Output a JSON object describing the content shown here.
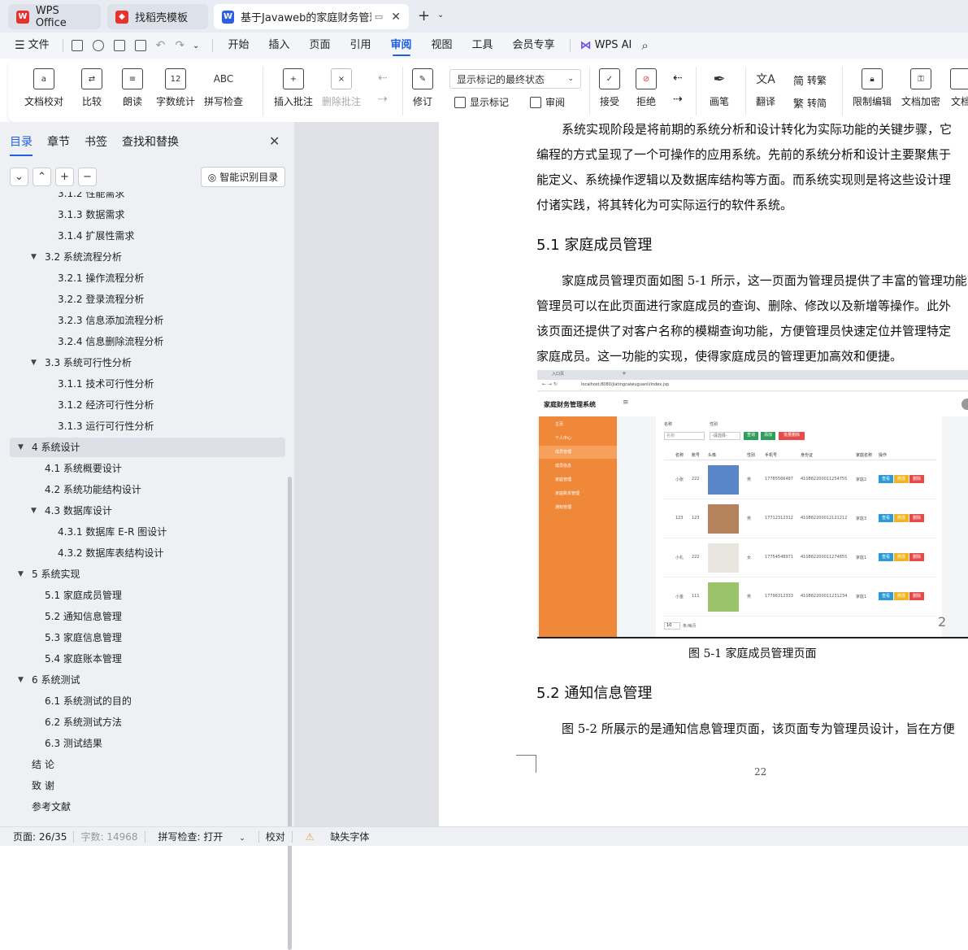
{
  "tabs": [
    {
      "label": "WPS Office"
    },
    {
      "label": "找稻壳模板"
    },
    {
      "label": "基于Javaweb的家庭财务管理"
    }
  ],
  "menu": {
    "file": "文件",
    "items": [
      "开始",
      "插入",
      "页面",
      "引用",
      "审阅",
      "视图",
      "工具",
      "会员专享"
    ],
    "active": "审阅",
    "ai": "WPS AI"
  },
  "ribbon": {
    "proofread": "文档校对",
    "compare": "比较",
    "read_aloud": "朗读",
    "word_count": "字数统计",
    "spell_check": "拼写检查",
    "insert_comment": "插入批注",
    "delete_comment": "删除批注",
    "revise": "修订",
    "display_mode": "显示标记的最终状态",
    "show_markup": "显示标记",
    "review": "审阅",
    "accept": "接受",
    "reject": "拒绝",
    "pen": "画笔",
    "translate": "翻译",
    "to_traditional": "转繁",
    "to_simplified": "转简",
    "restrict_edit": "限制编辑",
    "encrypt": "文档加密",
    "more": "文档"
  },
  "sidebar": {
    "tabs": [
      "目录",
      "章节",
      "书签",
      "查找和替换"
    ],
    "smart_btn": "智能识别目录",
    "toc": [
      {
        "label": "3.1.2 性能需求",
        "level": 3
      },
      {
        "label": "3.1.3 数据需求",
        "level": 3
      },
      {
        "label": "3.1.4 扩展性需求",
        "level": 3
      },
      {
        "label": "3.2 系统流程分析",
        "level": 2,
        "arrow": true
      },
      {
        "label": "3.2.1  操作流程分析",
        "level": 3
      },
      {
        "label": "3.2.2  登录流程分析",
        "level": 3
      },
      {
        "label": "3.2.3  信息添加流程分析",
        "level": 3
      },
      {
        "label": "3.2.4  信息删除流程分析",
        "level": 3
      },
      {
        "label": "3.3  系统可行性分析",
        "level": 2,
        "arrow": true
      },
      {
        "label": "3.1.1  技术可行性分析",
        "level": 3
      },
      {
        "label": "3.1.2  经济可行性分析",
        "level": 3
      },
      {
        "label": "3.1.3  运行可行性分析",
        "level": 3
      },
      {
        "label": "4  系统设计",
        "level": 1,
        "arrow": true,
        "selected": true
      },
      {
        "label": "4.1  系统概要设计",
        "level": 2
      },
      {
        "label": "4.2  系统功能结构设计",
        "level": 2
      },
      {
        "label": "4.3  数据库设计",
        "level": 2,
        "arrow": true
      },
      {
        "label": "4.3.1  数据库 E-R 图设计",
        "level": 3
      },
      {
        "label": "4.3.2  数据库表结构设计",
        "level": 3
      },
      {
        "label": "5  系统实现",
        "level": 1,
        "arrow": true
      },
      {
        "label": "5.1 家庭成员管理",
        "level": 2
      },
      {
        "label": "5.2  通知信息管理",
        "level": 2
      },
      {
        "label": "5.3 家庭信息管理",
        "level": 2
      },
      {
        "label": "5.4 家庭账本管理",
        "level": 2
      },
      {
        "label": "6  系统测试",
        "level": 1,
        "arrow": true
      },
      {
        "label": "6.1 系统测试的目的",
        "level": 2
      },
      {
        "label": "6.2 系统测试方法",
        "level": 2
      },
      {
        "label": "6.3  测试结果",
        "level": 2
      },
      {
        "label": "结   论",
        "level": 1
      },
      {
        "label": "致   谢",
        "level": 1
      },
      {
        "label": "参考文献",
        "level": 1
      }
    ]
  },
  "document": {
    "para1_lines": [
      "系统实现阶段是将前期的系统分析和设计转化为实际功能的关键步骤，它",
      "编程的方式呈现了一个可操作的应用系统。先前的系统分析和设计主要聚焦于",
      "能定义、系统操作逻辑以及数据库结构等方面。而系统实现则是将这些设计理",
      "付诸实践，将其转化为可实际运行的软件系统。"
    ],
    "heading1": "5.1 家庭成员管理",
    "para2_lines": [
      "家庭成员管理页面如图 5-1 所示，这一页面为管理员提供了丰富的管理功能",
      "管理员可以在此页面进行家庭成员的查询、删除、修改以及新增等操作。此外",
      "该页面还提供了对客户名称的模糊查询功能，方便管理员快速定位并管理特定",
      "家庭成员。这一功能的实现，使得家庭成员的管理更加高效和便捷。"
    ],
    "caption": "图 5-1  家庭成员管理页面",
    "heading2": "5.2  通知信息管理",
    "para3": "图 5-2 所展示的是通知信息管理页面，该页面专为管理员设计，旨在方便",
    "page_number": "22"
  },
  "screenshot": {
    "tab": "入口页",
    "url": "localhost:8080/jiatingcaiwuguanli/index.jsp",
    "app_title": "家庭财务管理系统",
    "menu": [
      "主页",
      "个人中心",
      "成员管理",
      "成员信息",
      "家庭管理",
      "家庭账本管理",
      "通知管理"
    ],
    "filters": {
      "name_label": "名称",
      "name_ph": "名称",
      "gender_label": "性别",
      "gender_ph": "-请选择-"
    },
    "buttons": {
      "search": "查询",
      "add": "添加",
      "batch_delete": "批量删除"
    },
    "columns": [
      "名称",
      "账号",
      "头像",
      "性别",
      "手机号",
      "身份证",
      "家庭名称",
      "操作"
    ],
    "rows": [
      {
        "name": "小张",
        "account": "222",
        "gender": "男",
        "phone": "17785566487",
        "id": "410882200011254755",
        "family": "家庭2"
      },
      {
        "name": "123",
        "account": "123",
        "gender": "男",
        "phone": "17712312312",
        "id": "410882200012121212",
        "family": "家庭3"
      },
      {
        "name": "小礼",
        "account": "222",
        "gender": "女",
        "phone": "17754548971",
        "id": "410882200011274855",
        "family": "家庭1"
      },
      {
        "name": "小金",
        "account": "111",
        "gender": "男",
        "phone": "17796312333",
        "id": "410882200011231234",
        "family": "家庭1"
      }
    ],
    "actions": [
      "查看",
      "修改",
      "删除"
    ],
    "page_size": "10",
    "page_size_label": "条/每页",
    "overlay_num": "2"
  },
  "status": {
    "page": "页面: 26/35",
    "words": "字数: 14968",
    "spell": "拼写检查: 打开",
    "proof": "校对",
    "missing_font": "缺失字体"
  },
  "colors": {
    "accent": "#1f5fe0",
    "orange": "#f0883a"
  }
}
